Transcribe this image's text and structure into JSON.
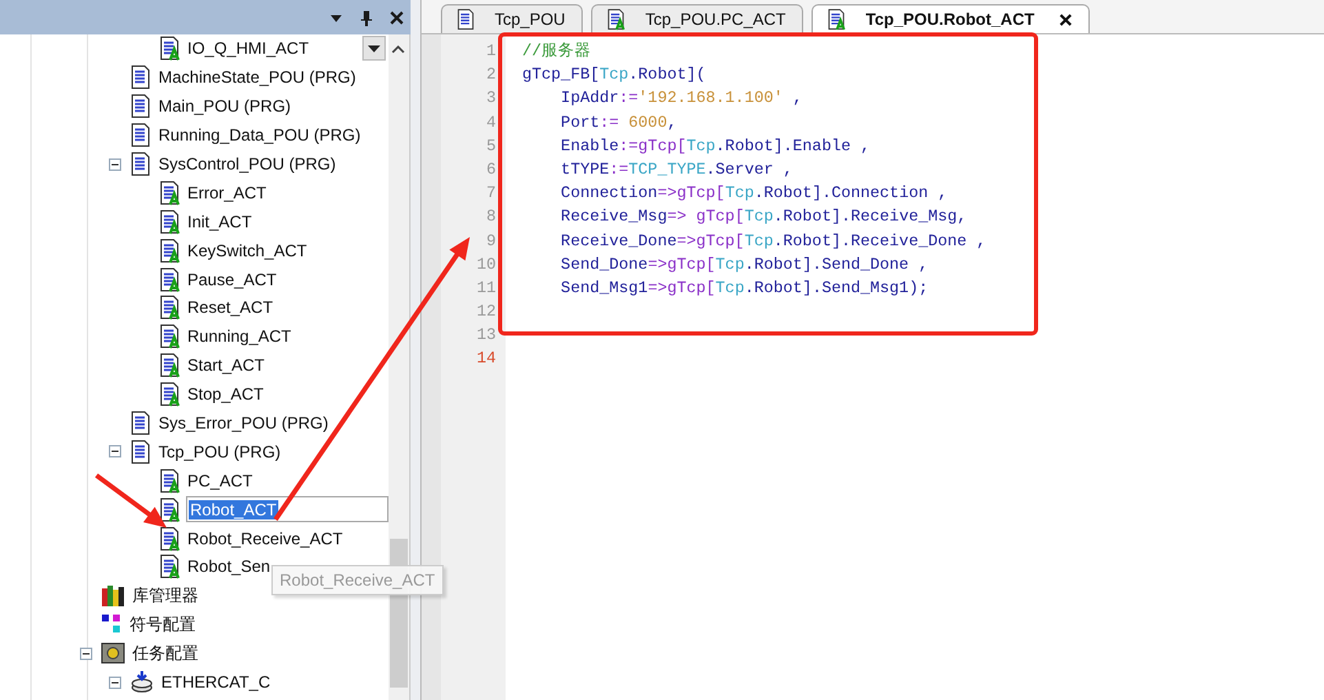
{
  "tree": [
    {
      "children": [
        {
          "children": [
            {
              "label": "IO_Q_HMI_ACT",
              "kind": "action",
              "selected": false
            }
          ]
        },
        {
          "label": "MachineState_POU (PRG)",
          "kind": "pou",
          "selected": false
        },
        {
          "label": "Main_POU (PRG)",
          "kind": "pou",
          "selected": false
        },
        {
          "label": "Running_Data_POU (PRG)",
          "kind": "pou",
          "selected": false
        },
        {
          "label": "SysControl_POU (PRG)",
          "kind": "pou",
          "selected": false,
          "expanded": true,
          "children": [
            {
              "label": "Error_ACT",
              "kind": "action",
              "selected": false
            },
            {
              "label": "Init_ACT",
              "kind": "action",
              "selected": false
            },
            {
              "label": "KeySwitch_ACT",
              "kind": "action",
              "selected": false
            },
            {
              "label": "Pause_ACT",
              "kind": "action",
              "selected": false
            },
            {
              "label": "Reset_ACT",
              "kind": "action",
              "selected": false
            },
            {
              "label": "Running_ACT",
              "kind": "action",
              "selected": false
            },
            {
              "label": "Start_ACT",
              "kind": "action",
              "selected": false
            },
            {
              "label": "Stop_ACT",
              "kind": "action",
              "selected": false
            }
          ]
        },
        {
          "label": "Sys_Error_POU (PRG)",
          "kind": "pou",
          "selected": false
        },
        {
          "label": "Tcp_POU (PRG)",
          "kind": "pou",
          "selected": false,
          "expanded": true,
          "children": [
            {
              "label": "PC_ACT",
              "kind": "action",
              "selected": false
            },
            {
              "label": "Robot_ACT",
              "kind": "action",
              "selected": true
            },
            {
              "label": "Robot_Receive_ACT",
              "kind": "action",
              "selected": false
            },
            {
              "label": "Robot_Sen",
              "kind": "action",
              "selected": false
            }
          ]
        }
      ]
    },
    {
      "label": "库管理器",
      "kind": "library",
      "selected": false
    },
    {
      "label": "符号配置",
      "kind": "symbols",
      "selected": false
    },
    {
      "label": "任务配置",
      "kind": "tasks",
      "selected": false,
      "expanded": true,
      "children": [
        {
          "label": "ETHERCAT_C",
          "kind": "ethercat",
          "selected": false,
          "expanded": true
        }
      ]
    }
  ],
  "tooltip": "Robot_Receive_ACT",
  "tabs": [
    {
      "label": "Tcp_POU",
      "kind": "pou",
      "selected": false
    },
    {
      "label": "Tcp_POU.PC_ACT",
      "kind": "action",
      "selected": false
    },
    {
      "label": "Tcp_POU.Robot_ACT",
      "kind": "action",
      "selected": true
    }
  ],
  "code_lines": [
    {
      "number": "1",
      "current": false,
      "segments": [
        {
          "text": "//服务器",
          "kind": "comment"
        }
      ]
    },
    {
      "number": "2",
      "current": false,
      "segments": [
        {
          "text": "gTcp_FB[",
          "kind": "plain"
        },
        {
          "text": "Tcp",
          "kind": "type"
        },
        {
          "text": ".Robot](",
          "kind": "plain"
        }
      ]
    },
    {
      "number": "3",
      "current": false,
      "segments": [
        {
          "text": "    IpAddr",
          "kind": "plain"
        },
        {
          "text": ":=",
          "kind": "op"
        },
        {
          "text": "'192.168.1.100'",
          "kind": "literal"
        },
        {
          "text": " ,",
          "kind": "plain"
        }
      ]
    },
    {
      "number": "4",
      "current": false,
      "segments": [
        {
          "text": "    Port",
          "kind": "plain"
        },
        {
          "text": ":=",
          "kind": "op"
        },
        {
          "text": " 6000",
          "kind": "literal"
        },
        {
          "text": ",",
          "kind": "plain"
        }
      ]
    },
    {
      "number": "5",
      "current": false,
      "segments": [
        {
          "text": "    Enable",
          "kind": "plain"
        },
        {
          "text": ":=",
          "kind": "op"
        },
        {
          "text": "gTcp[",
          "kind": "op"
        },
        {
          "text": "Tcp",
          "kind": "type"
        },
        {
          "text": ".Robot].Enable ,",
          "kind": "plain"
        }
      ]
    },
    {
      "number": "6",
      "current": false,
      "segments": [
        {
          "text": "    tTYPE",
          "kind": "plain"
        },
        {
          "text": ":=",
          "kind": "op"
        },
        {
          "text": "TCP_TYPE",
          "kind": "type"
        },
        {
          "text": ".Server ,",
          "kind": "plain"
        }
      ]
    },
    {
      "number": "7",
      "current": false,
      "segments": [
        {
          "text": "    Connection",
          "kind": "plain"
        },
        {
          "text": "=>",
          "kind": "op"
        },
        {
          "text": "gTcp[",
          "kind": "op"
        },
        {
          "text": "Tcp",
          "kind": "type"
        },
        {
          "text": ".Robot].Connection ,",
          "kind": "plain"
        }
      ]
    },
    {
      "number": "8",
      "current": false,
      "segments": [
        {
          "text": "    Receive_Msg",
          "kind": "plain"
        },
        {
          "text": "=>",
          "kind": "op"
        },
        {
          "text": " gTcp[",
          "kind": "op"
        },
        {
          "text": "Tcp",
          "kind": "type"
        },
        {
          "text": ".Robot].Receive_Msg,",
          "kind": "plain"
        }
      ]
    },
    {
      "number": "9",
      "current": false,
      "segments": [
        {
          "text": "    Receive_Done",
          "kind": "plain"
        },
        {
          "text": "=>",
          "kind": "op"
        },
        {
          "text": "gTcp[",
          "kind": "op"
        },
        {
          "text": "Tcp",
          "kind": "type"
        },
        {
          "text": ".Robot].Receive_Done ,",
          "kind": "plain"
        }
      ]
    },
    {
      "number": "10",
      "current": false,
      "segments": [
        {
          "text": "    Send_Done",
          "kind": "plain"
        },
        {
          "text": "=>",
          "kind": "op"
        },
        {
          "text": "gTcp[",
          "kind": "op"
        },
        {
          "text": "Tcp",
          "kind": "type"
        },
        {
          "text": ".Robot].Send_Done ,",
          "kind": "plain"
        }
      ]
    },
    {
      "number": "11",
      "current": false,
      "segments": [
        {
          "text": "    Send_Msg1",
          "kind": "plain"
        },
        {
          "text": "=>",
          "kind": "op"
        },
        {
          "text": "gTcp[",
          "kind": "op"
        },
        {
          "text": "Tcp",
          "kind": "type"
        },
        {
          "text": ".Robot].Send_Msg1);",
          "kind": "plain"
        }
      ]
    },
    {
      "number": "12",
      "current": false
    },
    {
      "number": "13",
      "current": false
    },
    {
      "number": "14",
      "current": true
    }
  ],
  "annotations": [
    {
      "kind": "frame"
    },
    {
      "kind": "arrow"
    },
    {
      "kind": "arrow"
    }
  ]
}
